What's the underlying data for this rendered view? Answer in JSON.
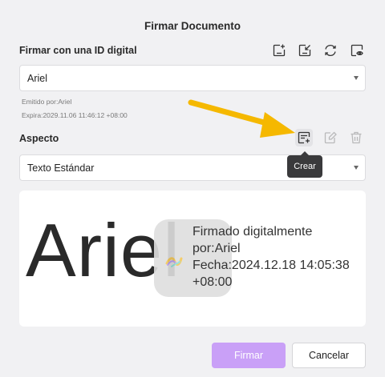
{
  "dialog": {
    "title": "Firmar Documento"
  },
  "digital_id": {
    "label": "Firmar con una ID digital",
    "selected": "Ariel",
    "issued_by": "Emitido por:Ariel",
    "expires": "Expira:2029.11.06 11:46:12 +08:00",
    "icons": [
      "add-id-icon",
      "import-id-icon",
      "refresh-icon",
      "view-id-icon"
    ]
  },
  "appearance": {
    "label": "Aspecto",
    "selected": "Texto Estándar",
    "icons": [
      "create-appearance-icon",
      "edit-appearance-icon",
      "delete-appearance-icon"
    ],
    "tooltip": "Crear"
  },
  "preview": {
    "name": "Ariel",
    "line1": "Firmado digitalmente",
    "line2": "por:Ariel",
    "line3": "Fecha:2024.12.18 14:05:38",
    "line4": "+08:00"
  },
  "buttons": {
    "sign": "Firmar",
    "cancel": "Cancelar"
  },
  "colors": {
    "primary": "#c9a0f7",
    "arrow": "#f5b800",
    "tooltip_bg": "#3a3a3c"
  }
}
